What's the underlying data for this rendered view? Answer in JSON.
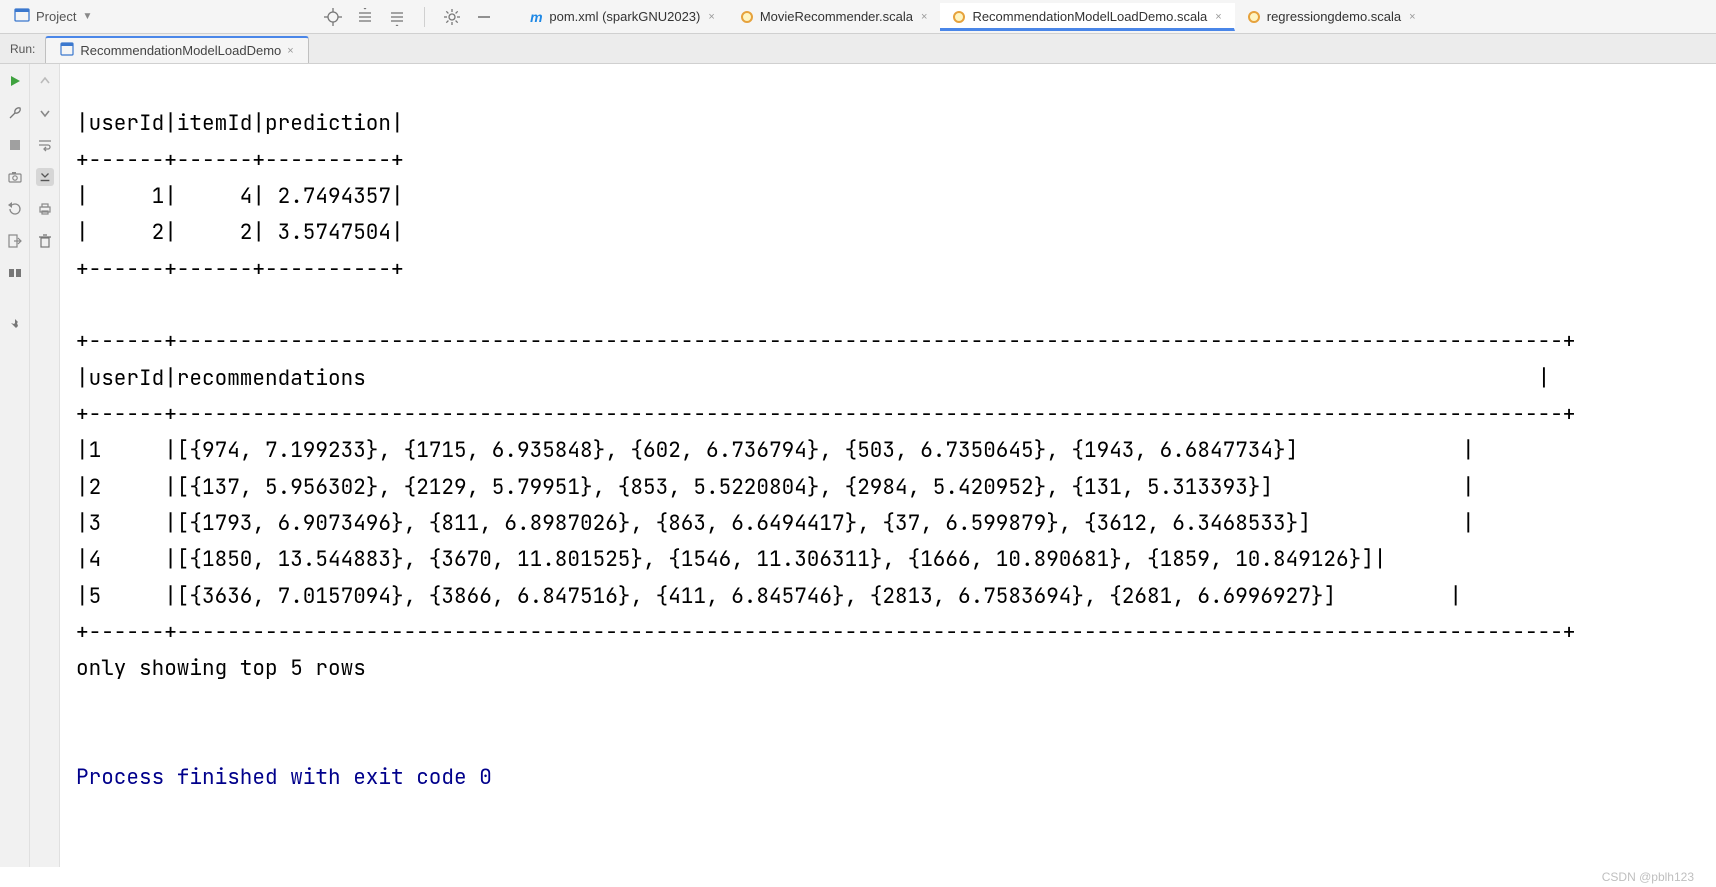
{
  "toolbar": {
    "project_label": "Project"
  },
  "editor_tabs": [
    {
      "label": "pom.xml (sparkGNU2023)",
      "icon": "m",
      "active": false
    },
    {
      "label": "MovieRecommender.scala",
      "icon": "circle",
      "active": false
    },
    {
      "label": "RecommendationModelLoadDemo.scala",
      "icon": "circle",
      "active": true
    },
    {
      "label": "regressiongdemo.scala",
      "icon": "circle",
      "active": false
    }
  ],
  "run": {
    "label": "Run:",
    "tab_label": "RecommendationModelLoadDemo"
  },
  "console_output": {
    "line0": "|userId|itemId|prediction|",
    "line1": "+------+------+----------+",
    "line2": "|     1|     4| 2.7494357|",
    "line3": "|     2|     2| 3.5747504|",
    "line4": "+------+------+----------+",
    "blank1": "",
    "line5": "+------+--------------------------------------------------------------------------------------------------------------+",
    "line6": "|userId|recommendations                                                                                             |",
    "line7": "+------+--------------------------------------------------------------------------------------------------------------+",
    "line8": "|1     |[{974, 7.199233}, {1715, 6.935848}, {602, 6.736794}, {503, 6.7350645}, {1943, 6.6847734}]             |",
    "line9": "|2     |[{137, 5.956302}, {2129, 5.79951}, {853, 5.5220804}, {2984, 5.420952}, {131, 5.313393}]               |",
    "line10": "|3     |[{1793, 6.9073496}, {811, 6.8987026}, {863, 6.6494417}, {37, 6.599879}, {3612, 6.3468533}]            |",
    "line11": "|4     |[{1850, 13.544883}, {3670, 11.801525}, {1546, 11.306311}, {1666, 10.890681}, {1859, 10.849126}]|",
    "line12": "|5     |[{3636, 7.0157094}, {3866, 6.847516}, {411, 6.845746}, {2813, 6.7583694}, {2681, 6.6996927}]         |",
    "line13": "+------+--------------------------------------------------------------------------------------------------------------+",
    "line14": "only showing top 5 rows",
    "blank2": "",
    "blank3": "",
    "exit_line": "Process finished with exit code 0"
  },
  "footer": {
    "watermark": "CSDN @pblh123"
  }
}
